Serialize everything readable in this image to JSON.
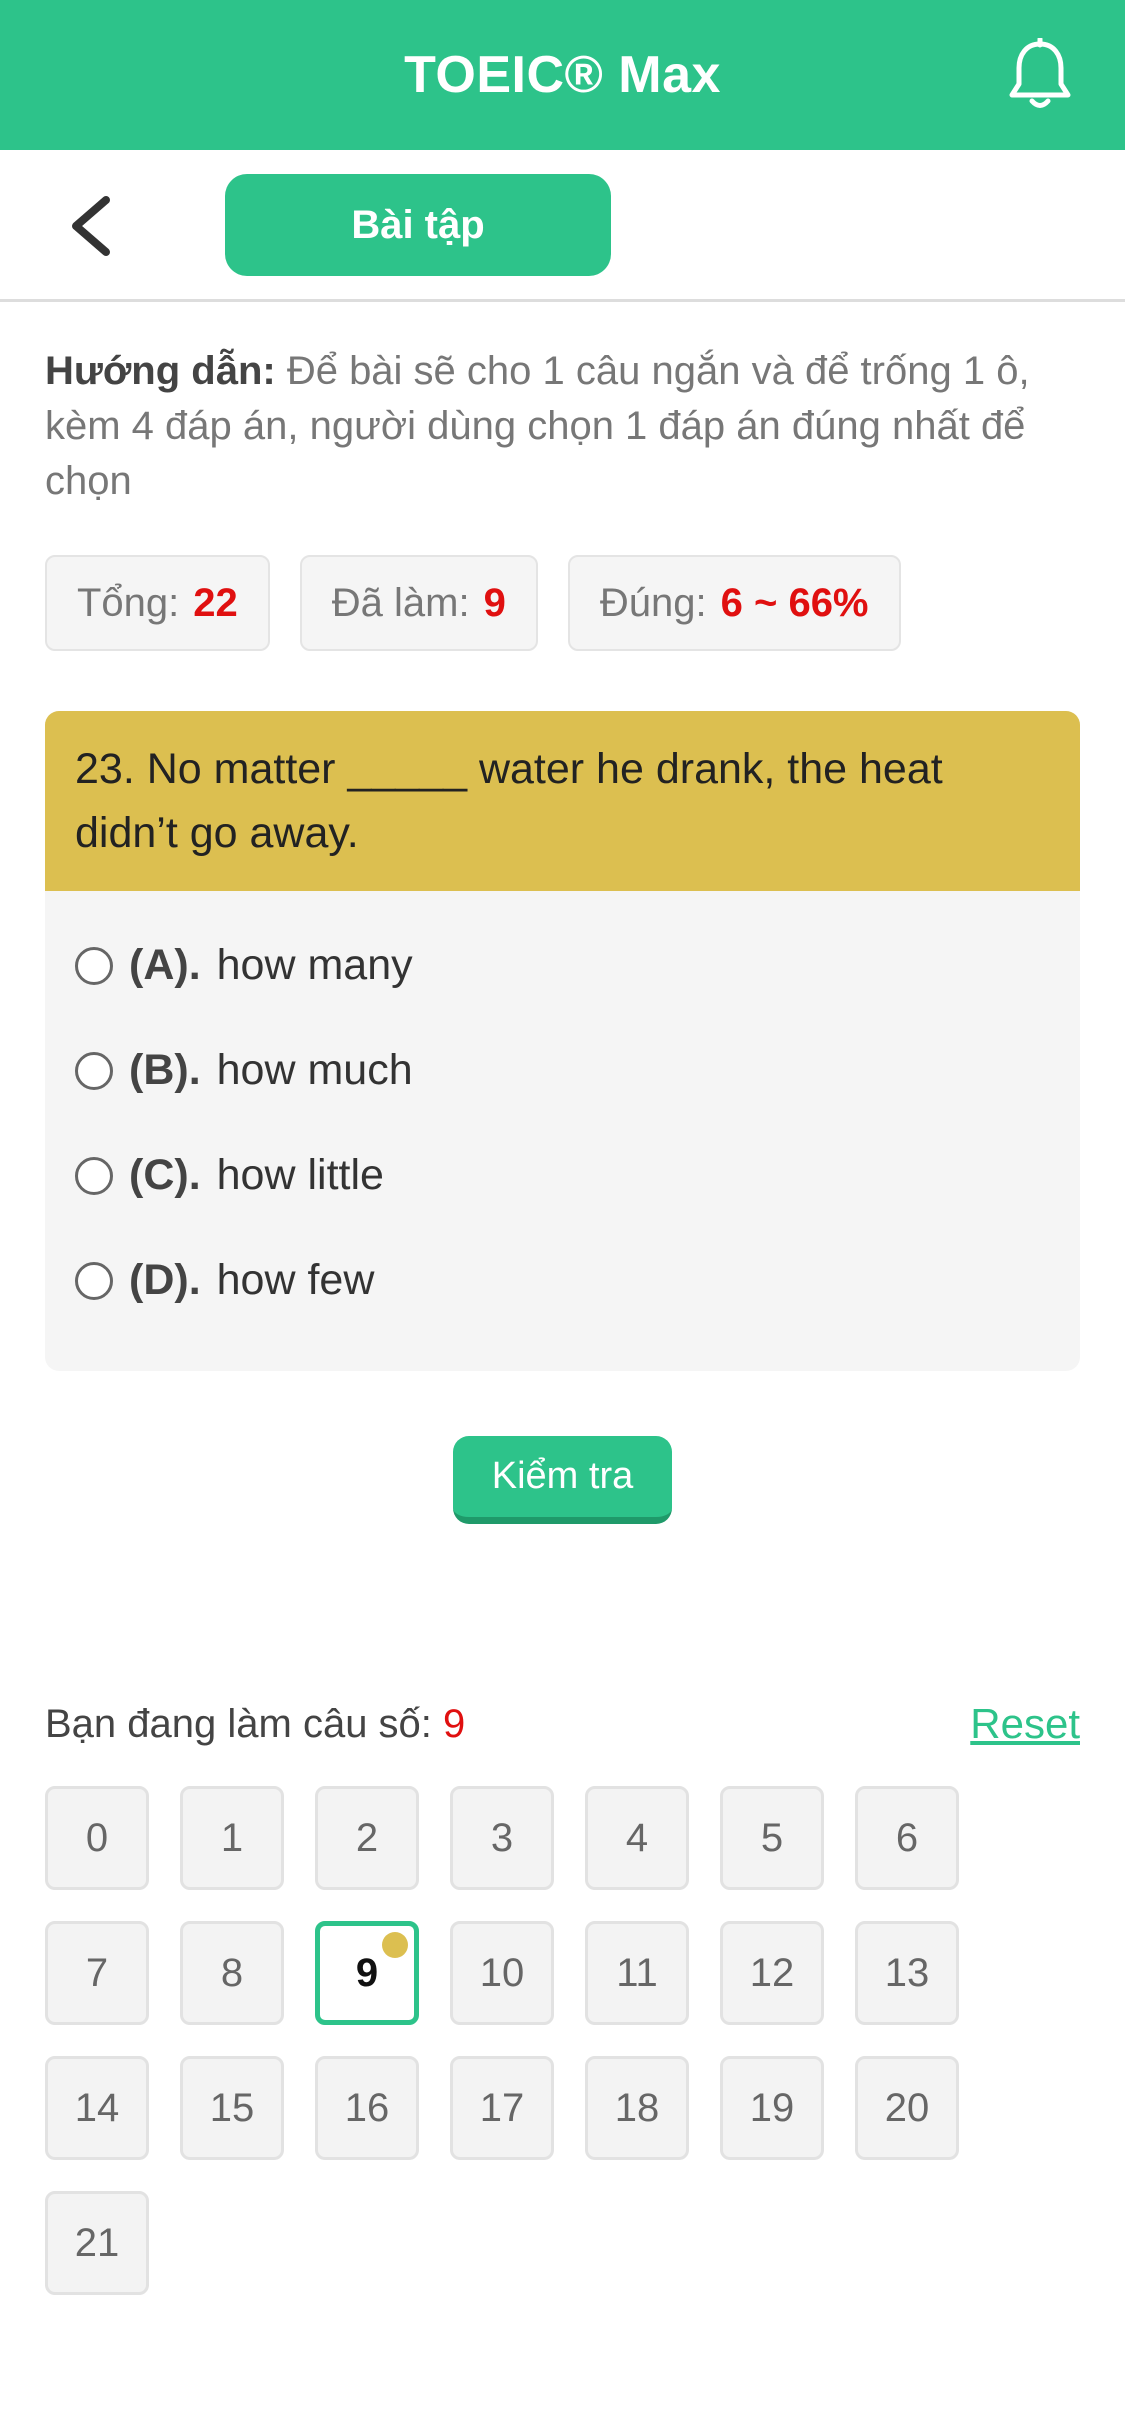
{
  "header": {
    "title": "TOEIC® Max",
    "icon": "bell-icon"
  },
  "toolbar": {
    "back_icon": "chevron-left-icon",
    "tab_label": "Bài tập"
  },
  "instruction": {
    "label": "Hướng dẫn:",
    "text": " Để bài sẽ cho 1 câu ngắn và để trống 1 ô, kèm 4 đáp án, người dùng chọn 1 đáp án đúng nhất để chọn"
  },
  "stats": [
    {
      "label": "Tổng:",
      "value": "22"
    },
    {
      "label": "Đã làm:",
      "value": "9"
    },
    {
      "label": "Đúng:",
      "value": "6 ~ 66%"
    }
  ],
  "question": {
    "text": "23. No matter _____ water he drank, the heat didn’t go away.",
    "options": [
      {
        "key": "(A).",
        "text": "how many"
      },
      {
        "key": "(B).",
        "text": "how much"
      },
      {
        "key": "(C).",
        "text": "how little"
      },
      {
        "key": "(D).",
        "text": "how few"
      }
    ]
  },
  "check_button": "Kiểm tra",
  "progress": {
    "label": "Bạn đang làm câu số:",
    "current": "9",
    "reset": "Reset",
    "numbers": [
      "0",
      "1",
      "2",
      "3",
      "4",
      "5",
      "6",
      "7",
      "8",
      "9",
      "10",
      "11",
      "12",
      "13",
      "14",
      "15",
      "16",
      "17",
      "18",
      "19",
      "20",
      "21"
    ],
    "active_index": 9
  },
  "colors": {
    "primary": "#2dc38a",
    "question_bg": "#dcbf50",
    "highlight": "#e01010"
  }
}
